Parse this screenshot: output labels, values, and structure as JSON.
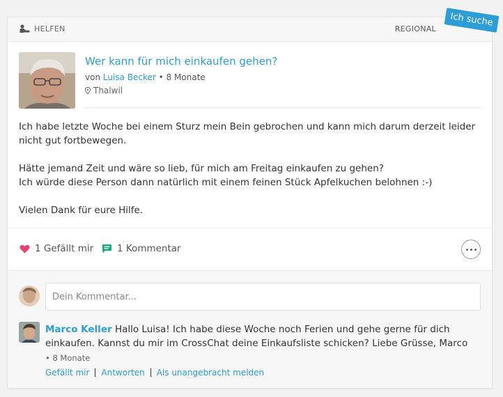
{
  "post": {
    "category": "HELFEN",
    "scope": "REGIONAL",
    "badge": "Ich suche",
    "title": "Wer kann für mich einkaufen gehen?",
    "by_prefix": "von",
    "author": "Luisa Becker",
    "time": "• 8 Monate",
    "location": "Thalwil",
    "body": [
      "Ich habe letzte Woche bei einem Sturz mein Bein gebrochen und kann mich darum derzeit leider nicht gut fortbewegen.",
      "Hätte jemand Zeit und wäre so lieb, für mich am Freitag einkaufen zu gehen?",
      "Ich würde diese Person dann natürlich mit einem feinen Stück Apfelkuchen belohnen :-)",
      "Vielen Dank für eure Hilfe."
    ]
  },
  "actions": {
    "likes": "1 Gefällt mir",
    "comments": "1 Kommentar"
  },
  "comment_box": {
    "placeholder": "Dein Kommentar..."
  },
  "comment": {
    "author": "Marco Keller",
    "text": "Hallo Luisa! Ich habe diese Woche noch Ferien und gehe gerne für dich einkaufen. Kannst du mir im CrossChat deine Einkaufsliste schicken? Liebe Grüsse, Marco",
    "time": "• 8 Monate",
    "like_link": "Gefällt mir",
    "reply_link": "Antworten",
    "report_link": "Als unangebracht melden"
  },
  "colors": {
    "accent": "#2c9ed5",
    "heart": "#e8416a",
    "comment_icon": "#1aa57f"
  },
  "icons": {
    "category": "helping-hand-icon",
    "location": "location-pin-icon",
    "like": "heart-icon",
    "comment": "comment-bubble-icon",
    "more": "more-dots-icon"
  }
}
